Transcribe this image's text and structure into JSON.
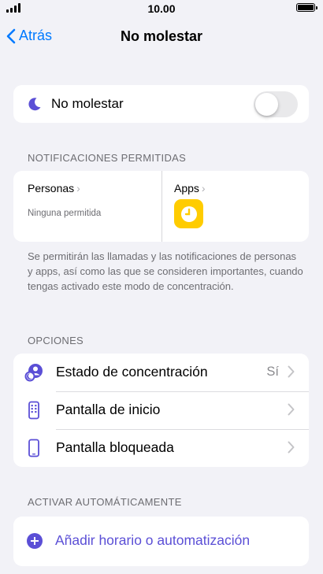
{
  "status_bar": {
    "time": "10.00"
  },
  "nav": {
    "back_label": "Atrás",
    "title": "No molestar"
  },
  "focus_toggle": {
    "label": "No molestar",
    "enabled": false
  },
  "allowed_notifications": {
    "header": "NOTIFICACIONES PERMITIDAS",
    "people": {
      "title": "Personas",
      "subtitle": "Ninguna permitida"
    },
    "apps": {
      "title": "Apps",
      "icon": "clock-icon"
    },
    "footnote": "Se permitirán las llamadas y las notificaciones de personas y apps, así como las que se consideren importantes, cuando tengas activado este modo de concentración."
  },
  "options": {
    "header": "OPCIONES",
    "items": [
      {
        "label": "Estado de concentración",
        "value": "Sí",
        "icon": "focus-status-icon"
      },
      {
        "label": "Pantalla de inicio",
        "value": "",
        "icon": "home-screen-icon"
      },
      {
        "label": "Pantalla bloqueada",
        "value": "",
        "icon": "lock-screen-icon"
      }
    ]
  },
  "auto_activate": {
    "header": "ACTIVAR AUTOMÁTICAMENTE",
    "add_label": "Añadir horario o automatización"
  },
  "colors": {
    "accent": "#5b4fd6",
    "link": "#007aff",
    "app_icon": "#ffcc00"
  }
}
